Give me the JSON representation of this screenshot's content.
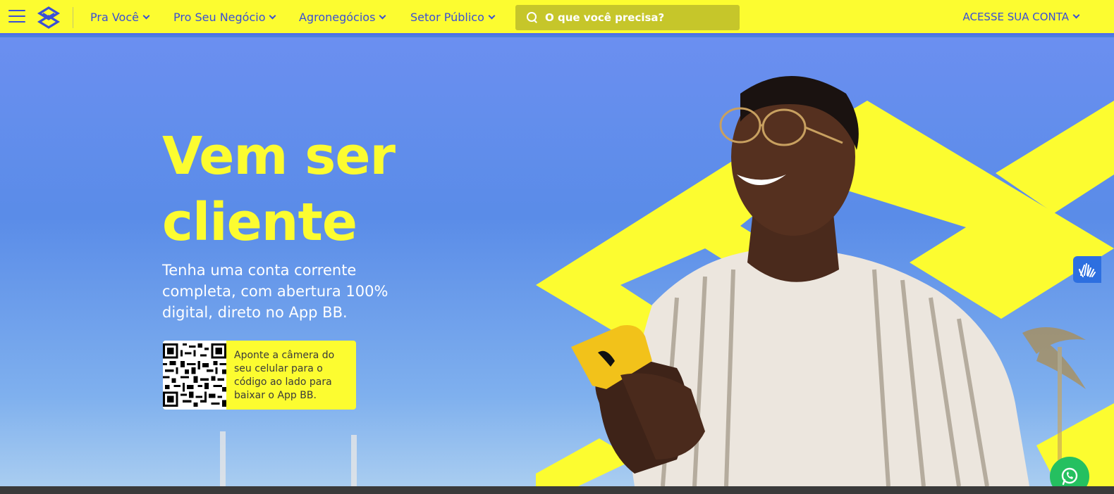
{
  "navbar": {
    "menu_icon": "hamburger-icon",
    "logo_icon": "banco-do-brasil-logo",
    "items": [
      {
        "label": "Pra Você"
      },
      {
        "label": "Pro Seu Negócio"
      },
      {
        "label": "Agronegócios"
      },
      {
        "label": "Setor Público"
      }
    ],
    "search": {
      "placeholder": "O que você precisa?",
      "icon": "search-icon"
    },
    "account_label": "ACESSE SUA CONTA"
  },
  "hero": {
    "headline_line1": "Vem ser",
    "headline_line2": "cliente",
    "subtitle": "Tenha uma conta corrente completa, com abertura 100% digital, direto no App BB.",
    "qr_text": "Aponte a câmera do seu celular para o código ao lado para baixar o App BB."
  },
  "widgets": {
    "accessibility_icon": "sign-language-hands-icon",
    "whatsapp_icon": "whatsapp-icon"
  },
  "colors": {
    "brand_yellow": "#fcfc30",
    "brand_blue": "#3a4fd6",
    "sky_blue": "#5a8ce8",
    "whatsapp_green": "#25c060"
  }
}
